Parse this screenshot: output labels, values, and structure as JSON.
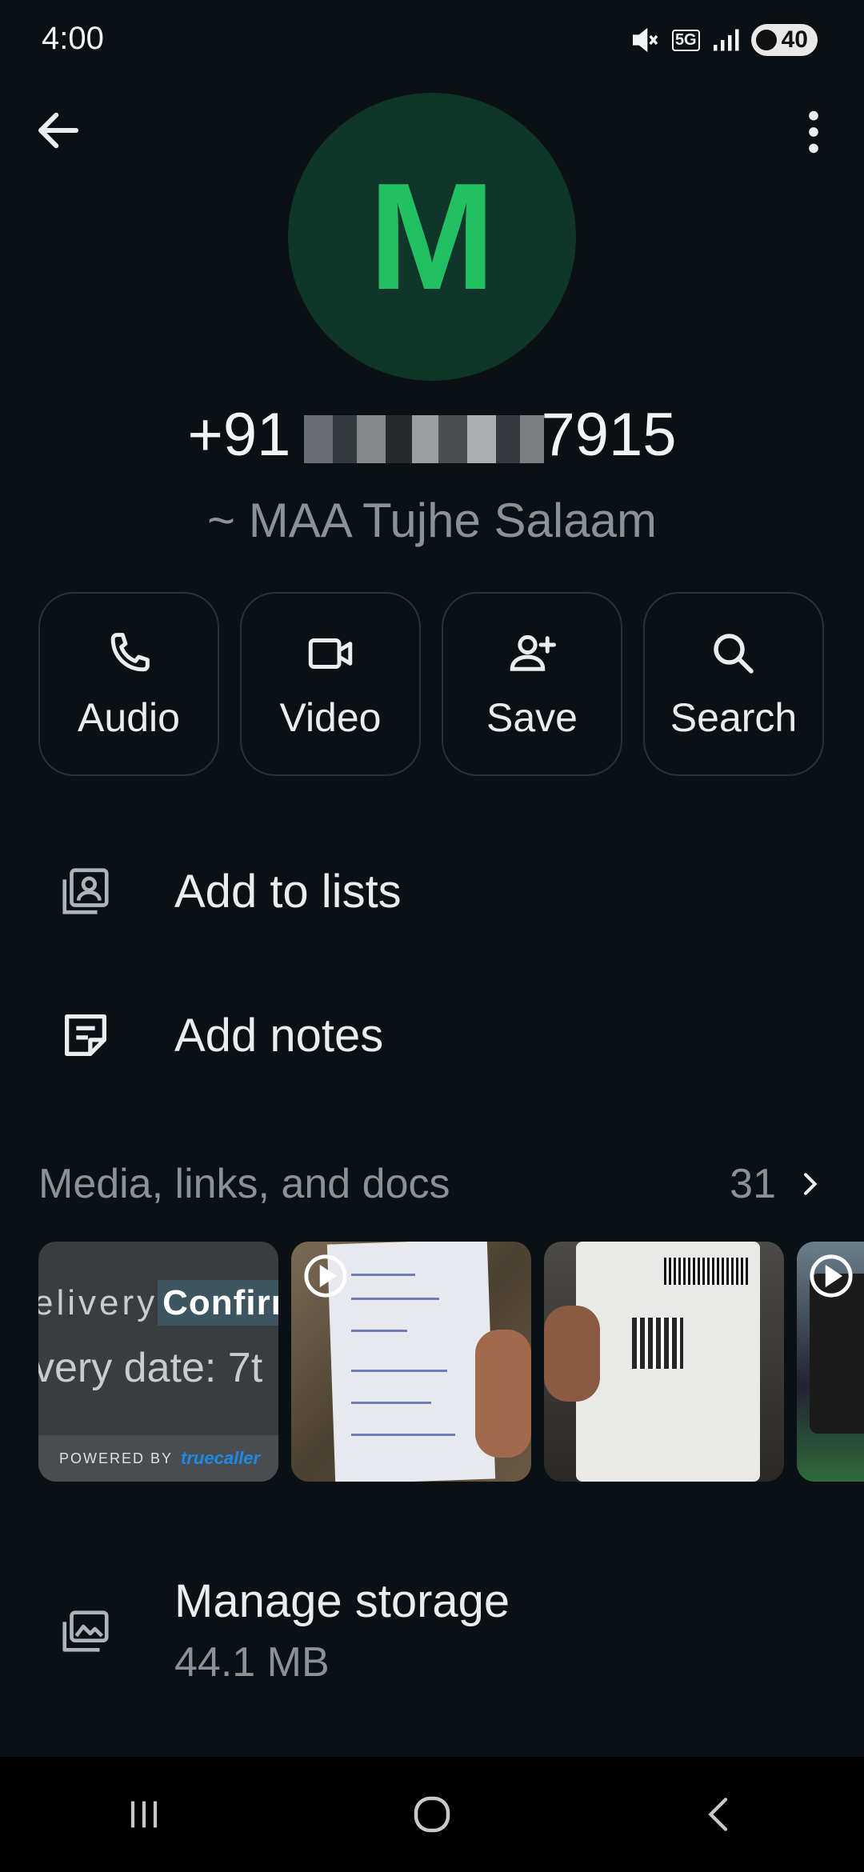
{
  "status_bar": {
    "time": "4:00",
    "battery": "40",
    "network": "5G"
  },
  "contact": {
    "avatar_letter": "M",
    "phone_prefix": "+91",
    "phone_suffix": "7915",
    "push_name": "~ MAA Tujhe Salaam"
  },
  "actions": [
    {
      "label": "Audio",
      "icon": "phone-icon"
    },
    {
      "label": "Video",
      "icon": "video-camera-icon"
    },
    {
      "label": "Save",
      "icon": "add-person-icon"
    },
    {
      "label": "Search",
      "icon": "search-icon"
    }
  ],
  "menu": {
    "add_to_lists": "Add to lists",
    "add_notes": "Add notes"
  },
  "media": {
    "title": "Media, links, and docs",
    "count": "31",
    "thumb1_line1_prefix": "elivery",
    "thumb1_line1_highlight": "Confirı",
    "thumb1_line2": "very date: 7t",
    "thumb1_footer": "POWERED BY",
    "thumb1_brand": "truecaller"
  },
  "storage": {
    "title": "Manage storage",
    "size": "44.1 MB"
  },
  "colors": {
    "background": "#0b1014",
    "avatar_bg": "#103529",
    "avatar_letter": "#21c063",
    "secondary_text": "#8a9197"
  }
}
